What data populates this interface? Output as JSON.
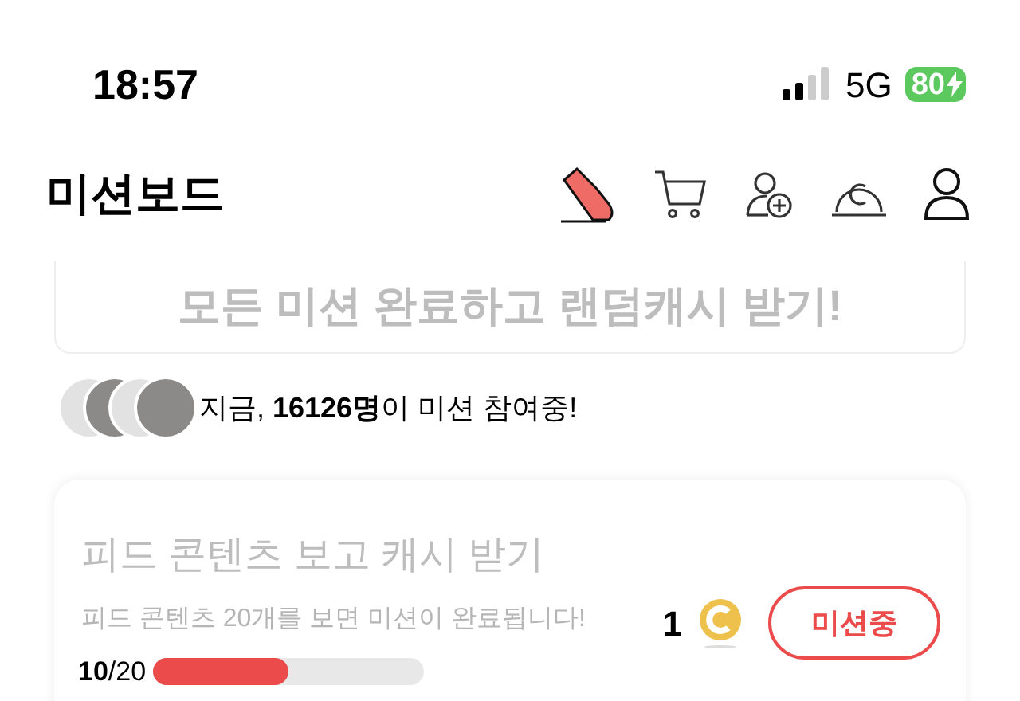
{
  "status_bar": {
    "time": "18:57",
    "network": "5G",
    "battery": "80"
  },
  "header": {
    "title": "미션보드"
  },
  "banner": {
    "text": "모든 미션 완료하고 랜덤캐시 받기!"
  },
  "participants": {
    "avatars": [
      {
        "kind": "placeholder"
      },
      {
        "kind": "photo"
      },
      {
        "kind": "placeholder"
      },
      {
        "kind": "photo"
      }
    ],
    "text": "지금, **16126명**이 미션 참여중!"
  },
  "missions": [
    {
      "title": "피드 콘텐츠 보고 캐시 받기",
      "description": "피드 콘텐츠 20개를 보면 미션이 완료됩니다!",
      "reward": "1",
      "button": "미션중",
      "progress_text": "**10**/20",
      "level": 0.5
    }
  ]
}
